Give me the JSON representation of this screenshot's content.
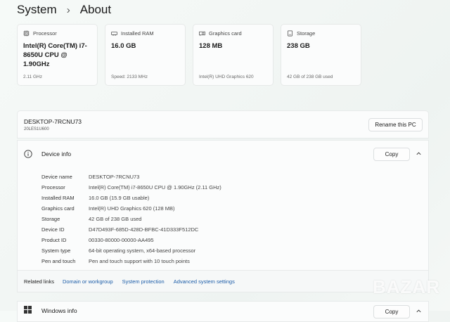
{
  "breadcrumb": {
    "parent": "System",
    "current": "About"
  },
  "specs": {
    "processor": {
      "label": "Processor",
      "value": "Intel(R) Core(TM) i7-8650U CPU @ 1.90GHz",
      "sub": "2.11 GHz"
    },
    "ram": {
      "label": "Installed RAM",
      "value": "16.0 GB",
      "sub": "Speed: 2133 MHz"
    },
    "graphics": {
      "label": "Graphics card",
      "value": "128 MB",
      "sub": "Intel(R) UHD Graphics 620"
    },
    "storage": {
      "label": "Storage",
      "value": "238 GB",
      "sub": "42 GB of 238 GB used"
    }
  },
  "pc": {
    "name": "DESKTOP-7RCNU73",
    "model": "20LES1U600",
    "rename_label": "Rename this PC"
  },
  "device_info": {
    "title": "Device info",
    "copy_label": "Copy",
    "rows": [
      {
        "label": "Device name",
        "value": "DESKTOP-7RCNU73"
      },
      {
        "label": "Processor",
        "value": "Intel(R) Core(TM) i7-8650U CPU @ 1.90GHz (2.11 GHz)"
      },
      {
        "label": "Installed RAM",
        "value": "16.0 GB (15.9 GB usable)"
      },
      {
        "label": "Graphics card",
        "value": "Intel(R) UHD Graphics 620 (128 MB)"
      },
      {
        "label": "Storage",
        "value": "42 GB of 238 GB used"
      },
      {
        "label": "Device ID",
        "value": "D47D493F-685D-428D-BFBC-41D333F512DC"
      },
      {
        "label": "Product ID",
        "value": "00330-80000-00000-AA495"
      },
      {
        "label": "System type",
        "value": "64-bit operating system, x64-based processor"
      },
      {
        "label": "Pen and touch",
        "value": "Pen and touch support with 10 touch points"
      }
    ]
  },
  "related_links": {
    "label": "Related links",
    "links": [
      "Domain or workgroup",
      "System protection",
      "Advanced system settings"
    ]
  },
  "windows_info": {
    "title": "Windows info",
    "copy_label": "Copy"
  },
  "watermark": "BAZAR",
  "icons": {
    "processor": "cpu-icon",
    "ram": "memory-icon",
    "graphics": "gpu-icon",
    "storage": "drive-icon",
    "info": "info-icon",
    "collapse": "chevron-up-icon",
    "windows": "windows-logo-icon",
    "breadcrumb_sep": "chevron-right-icon"
  },
  "colors": {
    "link": "#1c5da8",
    "background": "#f2f6f4",
    "card": "#fbfcfc"
  }
}
